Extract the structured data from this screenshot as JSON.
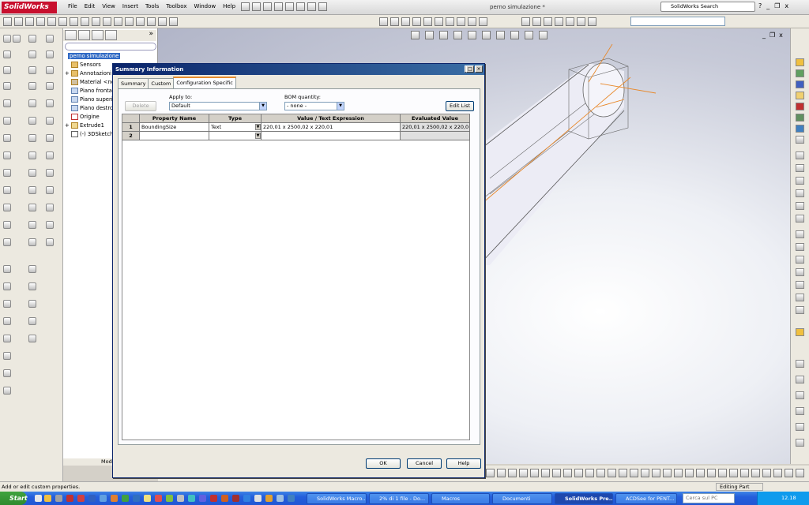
{
  "app": {
    "logo": "SolidWorks",
    "doc_title": "perno simulazione *",
    "search_placeholder": "SolidWorks Search"
  },
  "menu": [
    "File",
    "Edit",
    "View",
    "Insert",
    "Tools",
    "Toolbox",
    "Window",
    "Help"
  ],
  "window_controls": {
    "help": "?",
    "min": "_",
    "restore": "❐",
    "close": "x"
  },
  "feature_tree": {
    "root": "perno simulazione",
    "items": [
      {
        "label": "Sensors",
        "expander": ""
      },
      {
        "label": "Annotazioni",
        "expander": "+"
      },
      {
        "label": "Material <not",
        "expander": ""
      },
      {
        "label": "Piano frontale",
        "expander": ""
      },
      {
        "label": "Piano superio",
        "expander": ""
      },
      {
        "label": "Piano destro",
        "expander": ""
      },
      {
        "label": "Origine",
        "expander": ""
      },
      {
        "label": "Extrude1",
        "expander": "+"
      },
      {
        "label": "(-) 3DSketch2",
        "expander": ""
      }
    ],
    "model_tab": "Mod"
  },
  "dialog": {
    "title": "Summary Information",
    "controls": {
      "min": "_",
      "max": "□",
      "close": "×"
    },
    "tabs": [
      "Summary",
      "Custom",
      "Configuration Specific"
    ],
    "delete_label": "Delete",
    "apply_to_label": "Apply to:",
    "apply_to_value": "Default",
    "bom_label": "BOM quantity:",
    "bom_value": "- none -",
    "edit_list_label": "Edit List",
    "columns": [
      "Property Name",
      "Type",
      "Value / Text Expression",
      "Evaluated Value"
    ],
    "rows": [
      {
        "num": "1",
        "name": "BoundingSize",
        "type": "Text",
        "value": "220,01 x 2500,02 x 220,01",
        "evaluated": "220,01 x 2500,02 x 220,01"
      },
      {
        "num": "2",
        "name": "",
        "type": "",
        "value": "",
        "evaluated": ""
      }
    ],
    "ok_label": "OK",
    "cancel_label": "Cancel",
    "help_label": "Help"
  },
  "status": {
    "message": "Add or edit custom properties.",
    "mode": "Editing Part"
  },
  "taskbar": {
    "start": "Start",
    "tasks": [
      {
        "label": "SolidWorks Macro...",
        "active": false
      },
      {
        "label": "2% di 1 file - Do...",
        "active": false
      },
      {
        "label": "Macros",
        "active": false
      },
      {
        "label": "Documenti",
        "active": false
      },
      {
        "label": "SolidWorks Pre...",
        "active": true
      },
      {
        "label": "ACDSee for PENT...",
        "active": false
      }
    ],
    "search_placeholder": "Cerca sul PC",
    "clock": "12.18"
  },
  "colors": {
    "accent": "#0a246a",
    "taskbar": "#245edb",
    "selection": "#316ac5",
    "sketch_orange": "#e8882a"
  }
}
